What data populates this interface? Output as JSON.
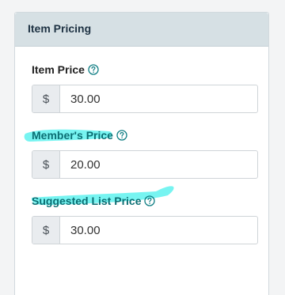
{
  "panel": {
    "title": "Item Pricing"
  },
  "fields": [
    {
      "label": "Item Price",
      "currency": "$",
      "value": "30.00"
    },
    {
      "label": "Member's Price",
      "currency": "$",
      "value": "20.00"
    },
    {
      "label": "Suggested List Price",
      "currency": "$",
      "value": "30.00"
    }
  ],
  "icons": {
    "help": "question-circle-icon"
  },
  "colors": {
    "header_bg": "#d6e0e4",
    "accent": "#0e7d83",
    "highlighter": "#5ff2ef"
  }
}
